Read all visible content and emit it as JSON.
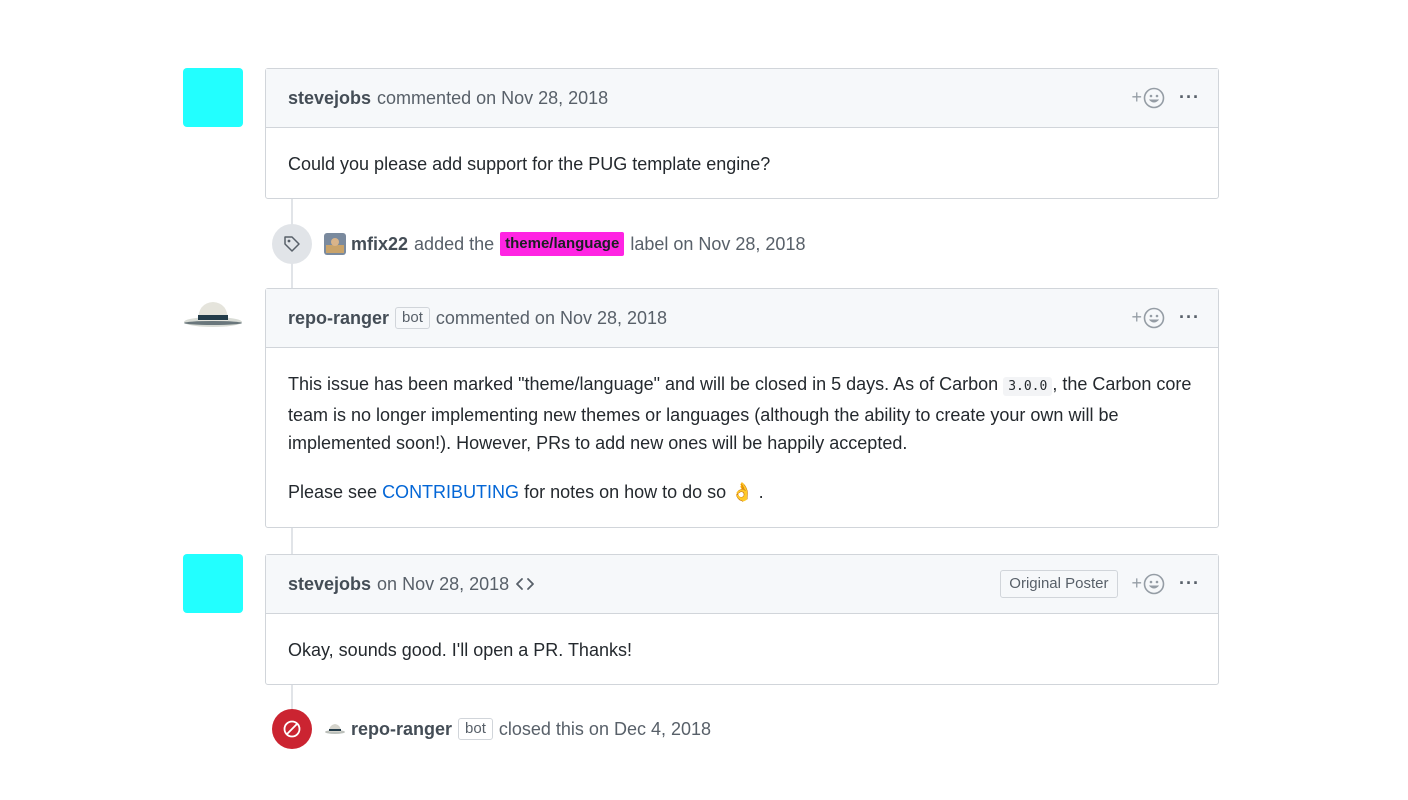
{
  "comments": [
    {
      "author": "stevejobs",
      "meta": "commented on Nov 28, 2018",
      "body": "Could you please add support for the PUG template engine?"
    },
    {
      "author": "repo-ranger",
      "badge": "bot",
      "meta": "commented on Nov 28, 2018",
      "body_p1_a": "This issue has been marked \"theme/language\" and will be closed in 5 days. As of Carbon ",
      "body_p1_code": "3.0.0",
      "body_p1_b": ", the Carbon core team is no longer implementing new themes or languages (although the ability to create your own will be implemented soon!). However, PRs to add new ones will be happily accepted.",
      "body_p2_a": "Please see ",
      "body_p2_link": "CONTRIBUTING",
      "body_p2_b": " for notes on how to do so",
      "body_p2_emoji": "👌",
      "body_p2_c": " ."
    },
    {
      "author": "stevejobs",
      "meta": "on Nov 28, 2018",
      "op_badge": "Original Poster",
      "body": "Okay, sounds good. I'll open a PR. Thanks!"
    }
  ],
  "events": [
    {
      "icon": "tag-icon",
      "actor": "mfix22",
      "pre": "added the",
      "label": "theme/language",
      "label_color": "#ff24e3",
      "post": "label on Nov 28, 2018"
    },
    {
      "icon": "circle-slash-icon",
      "actor": "repo-ranger",
      "badge": "bot",
      "post": "closed this on Dec 4, 2018",
      "icon_color": "#cb2431"
    }
  ],
  "reaction_plus": "+",
  "more_label": "···",
  "colors": {
    "avatar": "#22ffff",
    "link": "#0366d6"
  }
}
